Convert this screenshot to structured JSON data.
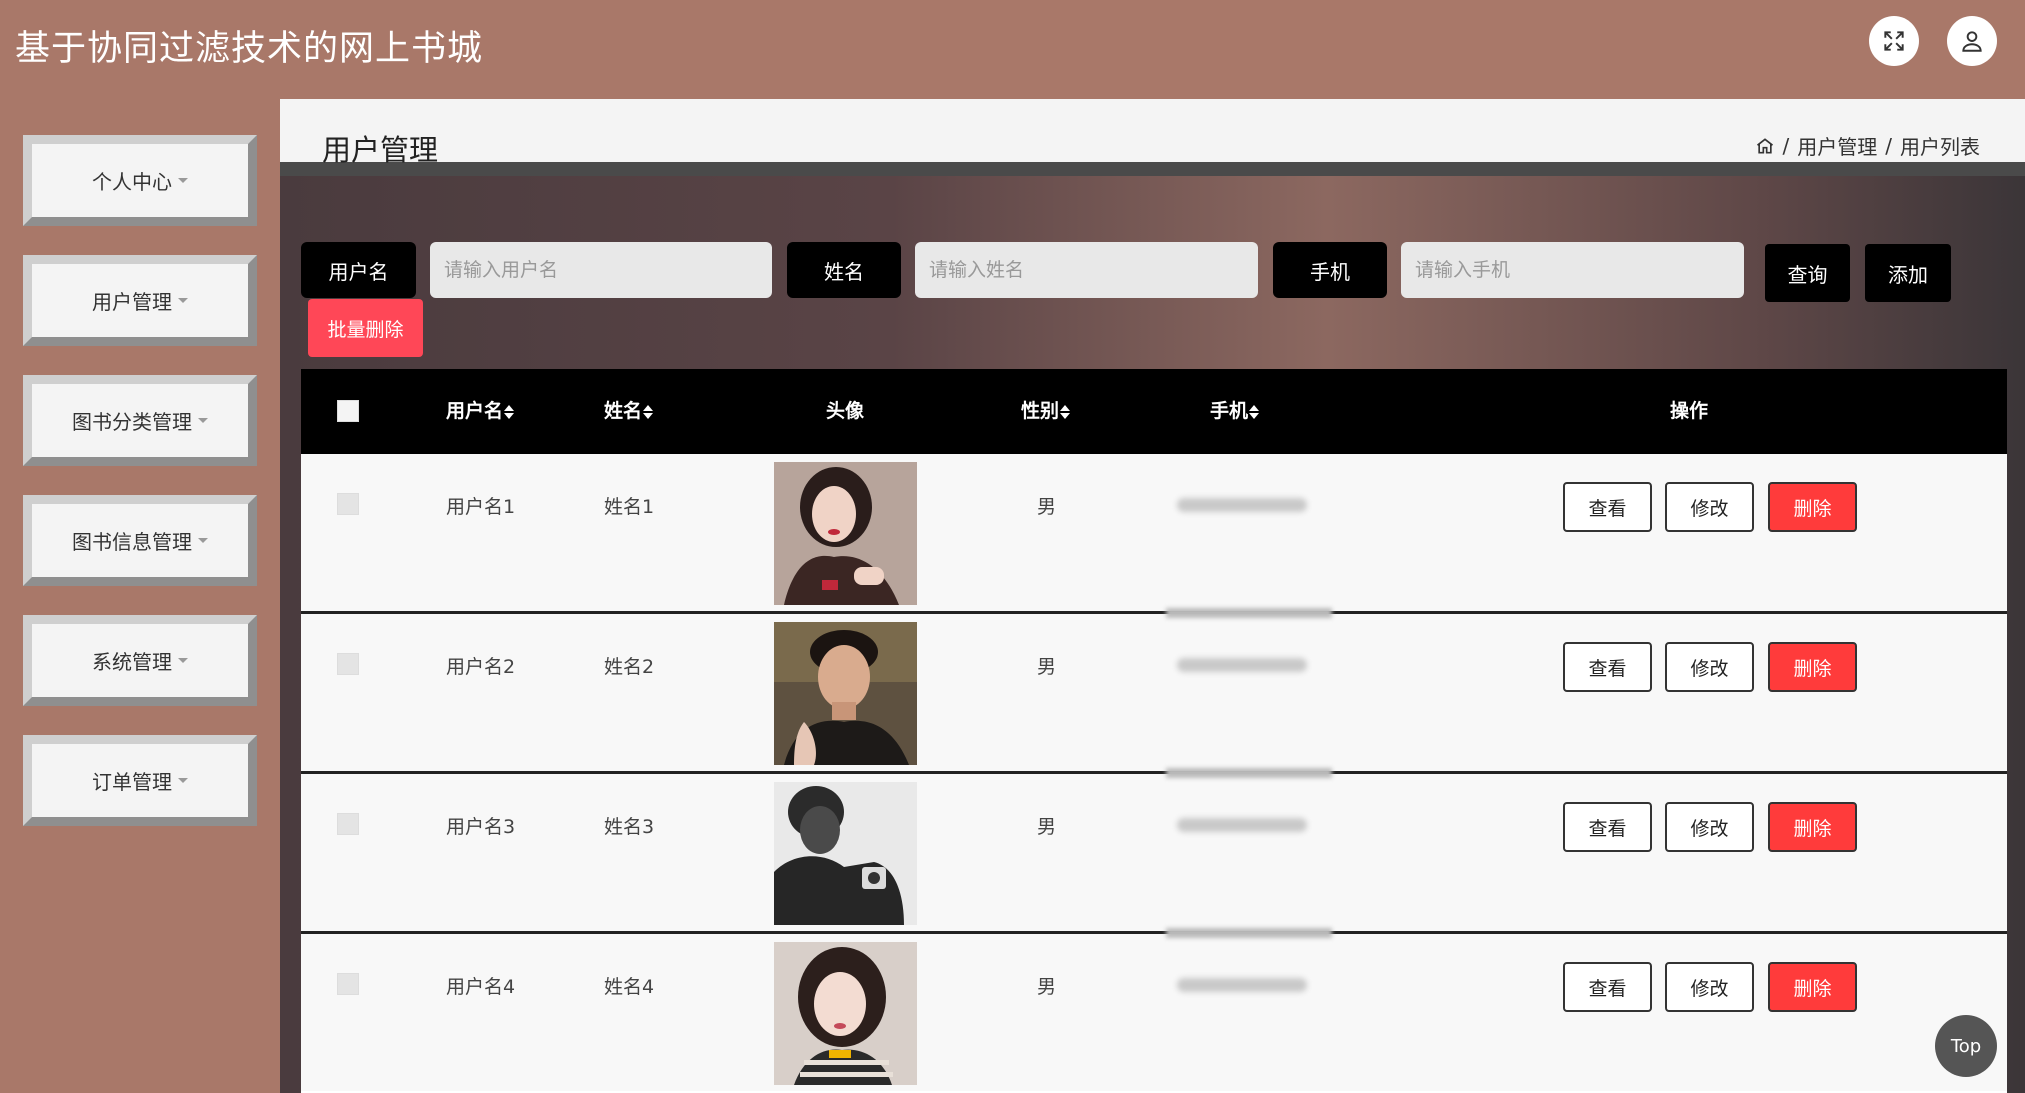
{
  "app": {
    "title": "基于协同过滤技术的网上书城"
  },
  "header": {
    "fullscreen_icon": "fullscreen-icon",
    "user_icon": "user-icon"
  },
  "sidebar": {
    "items": [
      {
        "label": "个人中心"
      },
      {
        "label": "用户管理"
      },
      {
        "label": "图书分类管理"
      },
      {
        "label": "图书信息管理"
      },
      {
        "label": "系统管理"
      },
      {
        "label": "订单管理"
      }
    ]
  },
  "page": {
    "title": "用户管理",
    "breadcrumb": {
      "icon": "home-icon",
      "items": [
        "用户管理",
        "用户列表"
      ],
      "separator": "/"
    }
  },
  "search": {
    "username_label": "用户名",
    "username_placeholder": "请输入用户名",
    "name_label": "姓名",
    "name_placeholder": "请输入姓名",
    "phone_label": "手机",
    "phone_placeholder": "请输入手机",
    "query_button": "查询",
    "add_button": "添加",
    "batch_delete_button": "批量删除"
  },
  "table": {
    "columns": [
      "用户名",
      "姓名",
      "头像",
      "性别",
      "手机",
      "操作"
    ],
    "rows": [
      {
        "username": "用户名1",
        "name": "姓名1",
        "gender": "男"
      },
      {
        "username": "用户名2",
        "name": "姓名2",
        "gender": "男"
      },
      {
        "username": "用户名3",
        "name": "姓名3",
        "gender": "男"
      },
      {
        "username": "用户名4",
        "name": "姓名4",
        "gender": "男"
      }
    ],
    "actions": {
      "view": "查看",
      "edit": "修改",
      "delete": "删除"
    }
  },
  "back_to_top": "Top",
  "colors": {
    "theme": "#a97869",
    "danger": "#ff3b3b",
    "batch_delete": "#ff4757"
  }
}
